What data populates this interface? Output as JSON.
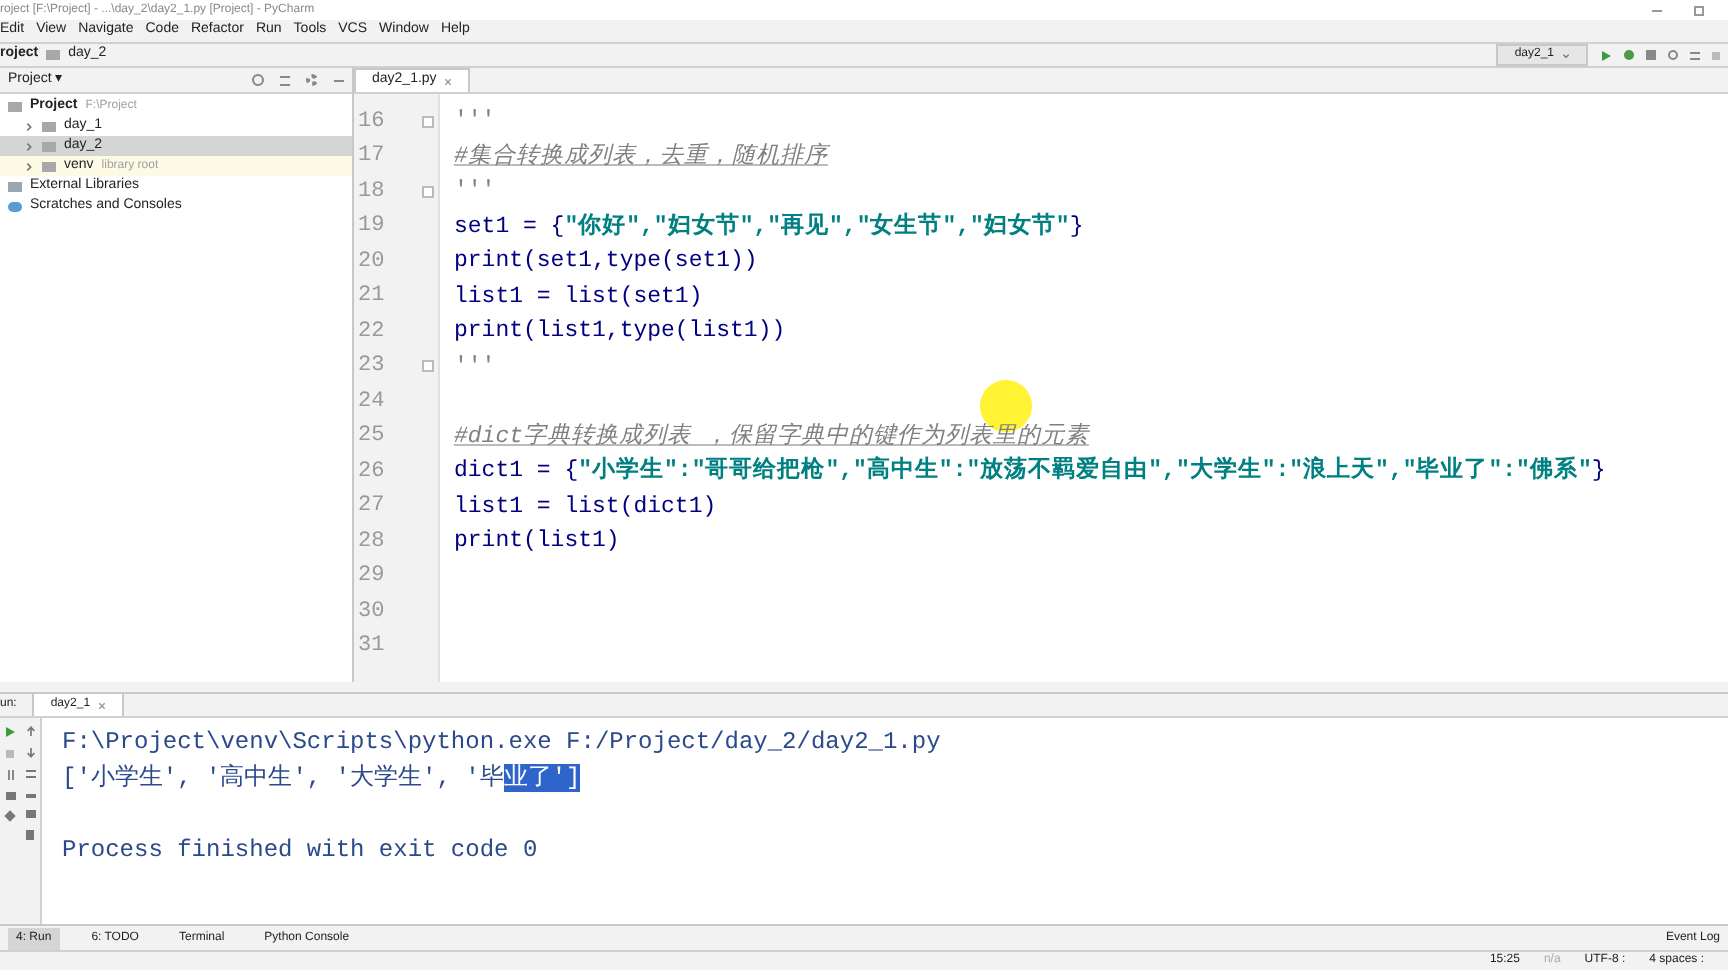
{
  "window": {
    "title": "roject [F:\\Project] - ...\\day_2\\day2_1.py [Project] - PyCharm"
  },
  "menu": [
    "Edit",
    "View",
    "Navigate",
    "Code",
    "Refactor",
    "Run",
    "Tools",
    "VCS",
    "Window",
    "Help"
  ],
  "breadcrumb": [
    "roject",
    "day_2"
  ],
  "run_config": "day2_1",
  "project_panel": {
    "title": "Project ▾",
    "tree": [
      {
        "label": "Project",
        "note": "F:\\Project",
        "kind": "root",
        "selected": false,
        "children": [
          {
            "label": "day_1",
            "kind": "folder",
            "selected": false,
            "expanded": false
          },
          {
            "label": "day_2",
            "kind": "folder",
            "selected": true,
            "expanded": false
          },
          {
            "label": "venv",
            "note": "library root",
            "kind": "lib",
            "selected": false,
            "expanded": false
          }
        ]
      },
      {
        "label": "External Libraries",
        "kind": "libs",
        "selected": false
      },
      {
        "label": "Scratches and Consoles",
        "kind": "scratch",
        "selected": false
      }
    ]
  },
  "editor": {
    "tabs": [
      {
        "label": "day2_1.py",
        "selected": true
      }
    ],
    "lines": [
      {
        "number": "16",
        "fold": true,
        "tokens": [
          {
            "kind": "doc",
            "text": "'''"
          }
        ]
      },
      {
        "number": "17",
        "fold": false,
        "tokens": [
          {
            "kind": "comment",
            "text": "#集合转换成列表，去重，随机排序"
          }
        ]
      },
      {
        "number": "18",
        "fold": true,
        "tokens": [
          {
            "kind": "doc",
            "text": "'''"
          }
        ]
      },
      {
        "number": "19",
        "fold": false,
        "tokens": [
          {
            "kind": "plain",
            "text": "set1 = {"
          },
          {
            "kind": "string",
            "text": "\"你好\",\"妇女节\",\"再见\",\"女生节\",\"妇女节\""
          },
          {
            "kind": "plain",
            "text": "}"
          }
        ]
      },
      {
        "number": "20",
        "fold": false,
        "tokens": [
          {
            "kind": "plain",
            "text": "print(set1,type(set1))"
          }
        ]
      },
      {
        "number": "21",
        "fold": false,
        "tokens": [
          {
            "kind": "plain",
            "text": "list1 = list(set1)"
          }
        ]
      },
      {
        "number": "22",
        "fold": false,
        "tokens": [
          {
            "kind": "plain",
            "text": "print(list1,type(list1))"
          }
        ]
      },
      {
        "number": "23",
        "fold": true,
        "tokens": [
          {
            "kind": "doc",
            "text": "'''"
          }
        ]
      },
      {
        "number": "24",
        "fold": false
      },
      {
        "number": "25",
        "fold": false,
        "tokens": [
          {
            "kind": "comment",
            "text": "#dict字典转换成列表 ，保留字典中的键作为列表里的元素"
          }
        ]
      },
      {
        "number": "26",
        "fold": false,
        "tokens": [
          {
            "kind": "plain",
            "text": "dict1 = {"
          },
          {
            "kind": "string",
            "text": "\"小学生\":\"哥哥给把枪\",\"高中生\":\"放荡不羁爱自由\",\"大学生\":\"浪上天\",\"毕业了\":\"佛系\""
          },
          {
            "kind": "plain",
            "text": "}"
          }
        ]
      },
      {
        "number": "27",
        "fold": false,
        "tokens": [
          {
            "kind": "plain",
            "text": "list1 = list(dict1)"
          }
        ]
      },
      {
        "number": "28",
        "fold": false,
        "tokens": [
          {
            "kind": "plain",
            "text": "print(list1)"
          }
        ]
      },
      {
        "number": "29",
        "fold": false
      },
      {
        "number": "30",
        "fold": false
      },
      {
        "number": "31",
        "fold": false
      }
    ]
  },
  "run_panel": {
    "label": "un:",
    "tabs": [
      {
        "label": "day2_1",
        "selected": true
      }
    ],
    "output": [
      {
        "kind": "command",
        "parts": [
          {
            "text": "F:\\Project\\venv\\Scripts\\python.exe F:/Project/day_2/day2_1.py",
            "selected": false
          }
        ]
      },
      {
        "kind": "output",
        "parts": [
          {
            "text": "['小学生', '高中生', '大学生', '毕",
            "selected": false
          },
          {
            "text": "业了']",
            "selected": true
          }
        ]
      },
      {
        "kind": "exit",
        "parts": [
          {
            "text": "Process finished with exit code 0",
            "selected": false
          }
        ]
      }
    ]
  },
  "tool_tabs": [
    {
      "label": "4: Run",
      "selected": true
    },
    {
      "label": "6: TODO",
      "selected": false
    },
    {
      "label": "Terminal",
      "selected": false
    },
    {
      "label": "Python Console",
      "selected": false
    }
  ],
  "event_log": "Event Log",
  "status_bar": [
    "15:25",
    "n/a",
    "UTF-8 :",
    "4 spaces :"
  ]
}
